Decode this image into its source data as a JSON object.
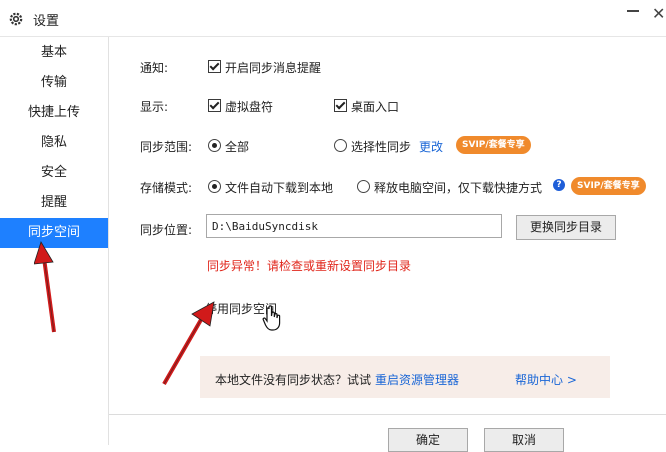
{
  "window": {
    "title": "设置",
    "close_glyph": "✕"
  },
  "sidebar": {
    "items": [
      {
        "label": "基本",
        "active": false
      },
      {
        "label": "传输",
        "active": false
      },
      {
        "label": "快捷上传",
        "active": false
      },
      {
        "label": "隐私",
        "active": false
      },
      {
        "label": "安全",
        "active": false
      },
      {
        "label": "提醒",
        "active": false
      },
      {
        "label": "同步空间",
        "active": true
      }
    ]
  },
  "content": {
    "notify": {
      "label": "通知:",
      "option": "开启同步消息提醒",
      "checked": true
    },
    "display": {
      "label": "显示:",
      "option1": "虚拟盘符",
      "option1_checked": true,
      "option2": "桌面入口",
      "option2_checked": true
    },
    "sync_scope": {
      "label": "同步范围:",
      "option1": "全部",
      "option2": "选择性同步",
      "selected": "全部",
      "change_link": "更改",
      "badge": "SVIP/套餐专享"
    },
    "storage_mode": {
      "label": "存储模式:",
      "option1": "文件自动下载到本地",
      "option2": "释放电脑空间，仅下载快捷方式",
      "selected": "文件自动下载到本地",
      "help_glyph": "?",
      "badge": "SVIP/套餐专享"
    },
    "sync_location": {
      "label": "同步位置:",
      "path": "D:\\BaiduSyncdisk",
      "change_button": "更换同步目录"
    },
    "error_message": "同步异常！请检查或重新设置同步目录",
    "disable_link": "停用同步空间",
    "hint": {
      "text": "本地文件没有同步状态？试试",
      "link": "重启资源管理器",
      "help_link": "帮助中心 >"
    }
  },
  "footer": {
    "ok_button": "确定",
    "cancel_button": "取消"
  },
  "colors": {
    "accent": "#1e80ff",
    "link": "#1a66d6",
    "badge": "#f08a2c",
    "error": "#e0261b",
    "annotation_arrow": "#d11a1a"
  },
  "icons": [
    "gear-icon",
    "minimize-icon",
    "close-icon",
    "help-icon",
    "hand-cursor-icon",
    "annotation-arrow"
  ]
}
